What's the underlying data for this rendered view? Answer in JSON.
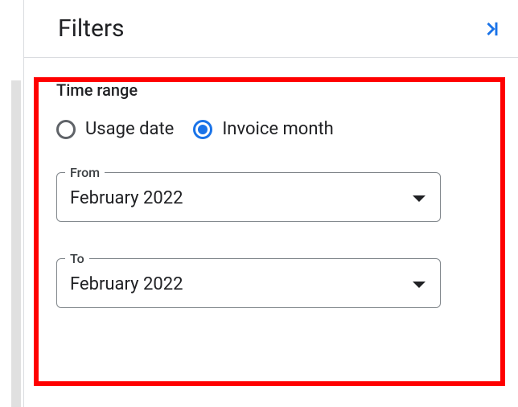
{
  "header": {
    "title": "Filters"
  },
  "timeRange": {
    "sectionTitle": "Time range",
    "radioOptions": {
      "usage": {
        "label": "Usage date",
        "selected": false
      },
      "invoice": {
        "label": "Invoice month",
        "selected": true
      }
    },
    "from": {
      "label": "From",
      "value": "February 2022"
    },
    "to": {
      "label": "To",
      "value": "February 2022"
    }
  }
}
